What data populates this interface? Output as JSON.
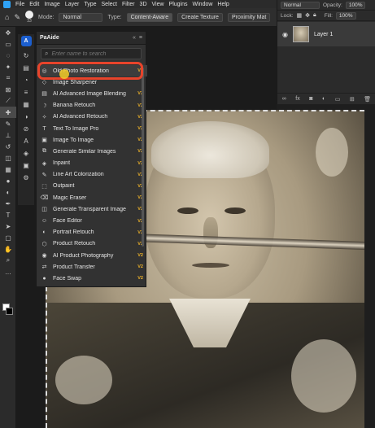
{
  "menubar": {
    "items": [
      "File",
      "Edit",
      "Image",
      "Layer",
      "Type",
      "Select",
      "Filter",
      "3D",
      "View",
      "Plugins",
      "Window",
      "Help"
    ]
  },
  "options": {
    "brush_size": "33",
    "mode_label": "Mode:",
    "mode_value": "Normal",
    "type_label": "Type:",
    "type_value": "Content-Aware",
    "create_texture": "Create Texture",
    "proximity": "Proximity Mat"
  },
  "layers_panel": {
    "blend_mode": "Normal",
    "opacity_label": "Opacity:",
    "opacity_value": "100%",
    "lock_label": "Lock:",
    "fill_label": "Fill:",
    "fill_value": "100%",
    "layer_name": "Layer 1"
  },
  "plugin_panel": {
    "title": "PaAide",
    "search_placeholder": "Enter name to search",
    "items": [
      {
        "label": "Old Photo Restoration",
        "badge": "V2",
        "icon": "restore-icon"
      },
      {
        "label": "Image Sharpener",
        "badge": "",
        "icon": "sharpen-icon"
      },
      {
        "label": "AI Advanced Image Blending",
        "badge": "V2",
        "icon": "blend-icon"
      },
      {
        "label": "Banana Retouch",
        "badge": "V2",
        "icon": "banana-icon"
      },
      {
        "label": "AI Advanced Retouch",
        "badge": "V2",
        "icon": "retouch-icon"
      },
      {
        "label": "Text To Image Pro",
        "badge": "V2",
        "icon": "text-image-icon"
      },
      {
        "label": "Image To Image",
        "badge": "V2",
        "icon": "image-image-icon"
      },
      {
        "label": "Generate Similar Images",
        "badge": "V2",
        "icon": "similar-icon"
      },
      {
        "label": "Inpaint",
        "badge": "V2",
        "icon": "inpaint-icon"
      },
      {
        "label": "Line Art Colorization",
        "badge": "V2",
        "icon": "lineart-icon"
      },
      {
        "label": "Outpaint",
        "badge": "V2",
        "icon": "outpaint-icon"
      },
      {
        "label": "Magic Eraser",
        "badge": "V2",
        "icon": "eraser-icon"
      },
      {
        "label": "Generate Transparent Image",
        "badge": "V2",
        "icon": "transparent-icon"
      },
      {
        "label": "Face Editor",
        "badge": "V2",
        "icon": "face-editor-icon"
      },
      {
        "label": "Portrait Retouch",
        "badge": "V2",
        "icon": "portrait-icon"
      },
      {
        "label": "Product Retouch",
        "badge": "V2",
        "icon": "product-retouch-icon"
      },
      {
        "label": "AI Product Photography",
        "badge": "V2",
        "icon": "camera-icon"
      },
      {
        "label": "Product Transfer",
        "badge": "V2",
        "icon": "transfer-icon"
      },
      {
        "label": "Face Swap",
        "badge": "V2",
        "icon": "face-swap-icon"
      }
    ]
  },
  "colors": {
    "highlight": "#e8442b",
    "badge": "#f0b429",
    "accent": "#1c5fcf"
  }
}
